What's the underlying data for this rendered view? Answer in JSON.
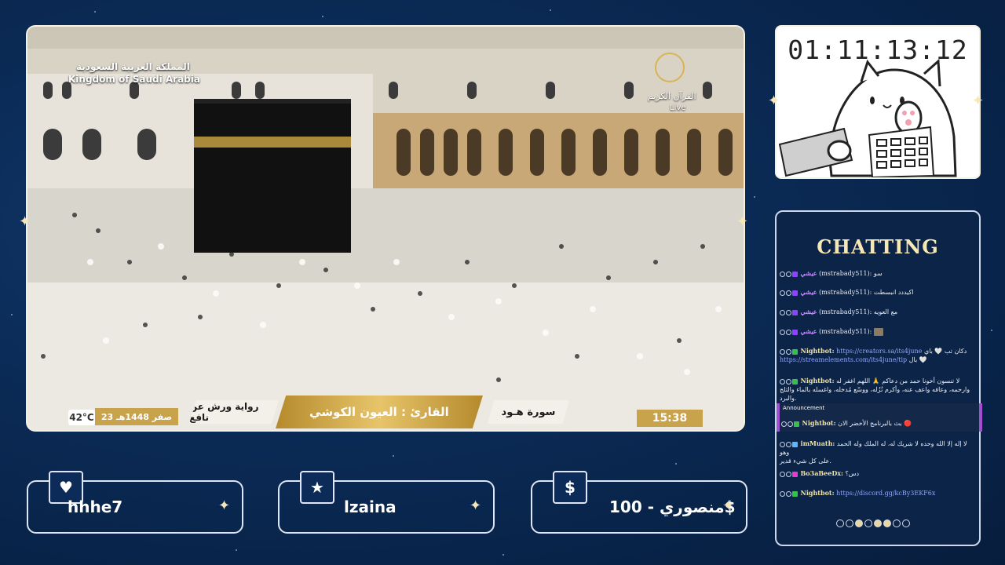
{
  "video": {
    "ksa_arabic": "المملكة العربية السعودية",
    "ksa_english": "Kingdom of Saudi Arabia",
    "channel_arabic": "القرآن الكريم",
    "live_label": "Live",
    "temperature": "42°C",
    "hijri_date": "23 صفر 1448هـ",
    "riwaya": "رواية ورش عن نافع",
    "reciter": "القارئ : العيون الكوشي",
    "surah": "سورة هـود",
    "clock": "15:38"
  },
  "timer": {
    "value": "01:11:13:12"
  },
  "chat": {
    "title": "CHATTING",
    "messages": [
      {
        "user": "عيشي",
        "handle": "(mstrabady511):",
        "text": "سو"
      },
      {
        "user": "عيشي",
        "handle": "(mstrabady511):",
        "text": "اكيددد انبسطت"
      },
      {
        "user": "عيشي",
        "handle": "(mstrabady511):",
        "text": "مع العويه"
      },
      {
        "user": "عيشي",
        "handle": "(mstrabady511):",
        "text": ""
      },
      {
        "user": "Nightbot:",
        "text": "دكان تب 🤍 باي",
        "link1": "https://creators.sa/its4june",
        "link2": "https://streamelements.com/its4june/tip",
        "text2": "بال 🤍"
      },
      {
        "user": "Nightbot:",
        "text": "لا تنسون أخونا حمد من دعاكم 🙏 اللهم اغفر له",
        "text2": "وارحمه، وعافه واعف عنه، وأكرم نُزُله، ووسّع مُدخله، واغسله بالماء والثلج والبرد."
      },
      {
        "announcement": "Announcement",
        "user": "Nightbot:",
        "text": "بث بالبرنامج الأخضر الان 🔴"
      },
      {
        "user": "imMuath:",
        "text": "لا إله إلا الله وحده لا شريك له، له الملك وله الحمد وهو",
        "text2": "على كل شيء قدير."
      },
      {
        "user": "Bo3aBeeDx:",
        "text": "دس؟"
      },
      {
        "user": "Nightbot:",
        "link1": "https://discord.gg/kcBy3EKF6x"
      }
    ]
  },
  "supporters": [
    {
      "icon": "heart-icon",
      "name": "hhhe7"
    },
    {
      "icon": "star-icon",
      "name": "lzaina"
    },
    {
      "icon": "dollar-icon",
      "symbol": "$",
      "name": "منصوري - 100$"
    }
  ],
  "colors": {
    "background": "#0a2a55",
    "gold": "#c9a34b",
    "accent_purple": "#a14fd1"
  }
}
